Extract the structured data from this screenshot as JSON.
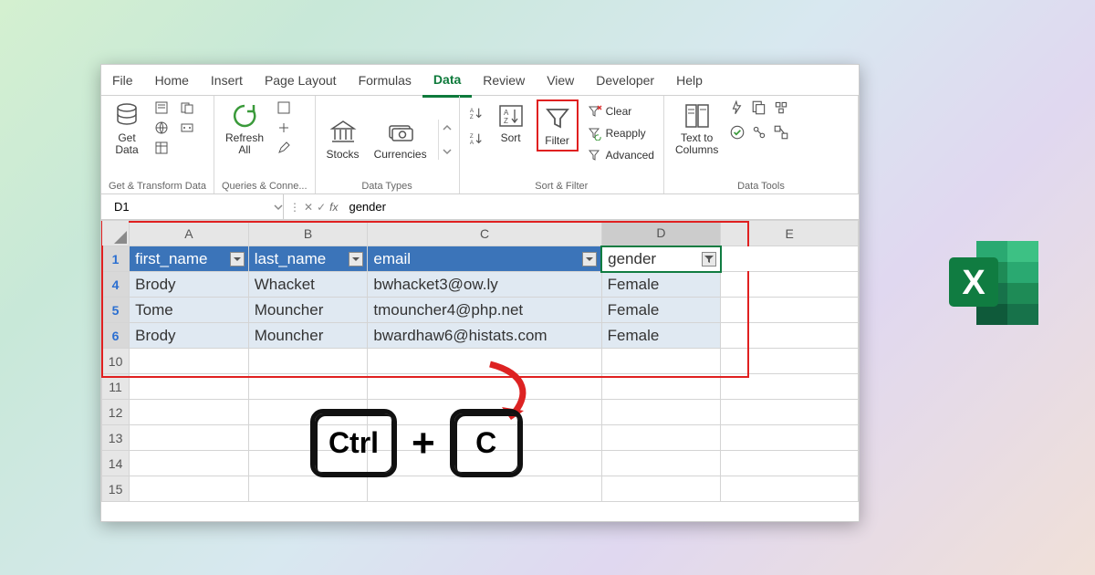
{
  "tabs": [
    "File",
    "Home",
    "Insert",
    "Page Layout",
    "Formulas",
    "Data",
    "Review",
    "View",
    "Developer",
    "Help"
  ],
  "active_tab": "Data",
  "ribbon": {
    "group1": {
      "get_data": "Get\nData",
      "label": "Get & Transform Data"
    },
    "group2": {
      "refresh": "Refresh\nAll",
      "label": "Queries & Conne..."
    },
    "group3": {
      "stocks": "Stocks",
      "currencies": "Currencies",
      "label": "Data Types"
    },
    "group4": {
      "sort": "Sort",
      "filter": "Filter",
      "clear": "Clear",
      "reapply": "Reapply",
      "advanced": "Advanced",
      "label": "Sort & Filter"
    },
    "group5": {
      "ttc": "Text to\nColumns",
      "label": "Data Tools"
    }
  },
  "namebox": "D1",
  "formula": "gender",
  "columns": [
    "A",
    "B",
    "C",
    "D",
    "E"
  ],
  "visible_row_headers": [
    "1",
    "4",
    "5",
    "6",
    "10",
    "11",
    "12",
    "13",
    "14",
    "15"
  ],
  "headers": {
    "A": "first_name",
    "B": "last_name",
    "C": "email",
    "D": "gender"
  },
  "rows": [
    {
      "r": "4",
      "A": "Brody",
      "B": "Whacket",
      "C": "bwhacket3@ow.ly",
      "D": "Female"
    },
    {
      "r": "5",
      "A": "Tome",
      "B": "Mouncher",
      "C": "tmouncher4@php.net",
      "D": "Female"
    },
    {
      "r": "6",
      "A": "Brody",
      "B": "Mouncher",
      "C": "bwardhaw6@histats.com",
      "D": "Female"
    }
  ],
  "keys": {
    "k1": "Ctrl",
    "plus": "+",
    "k2": "C"
  },
  "logo_letter": "X"
}
